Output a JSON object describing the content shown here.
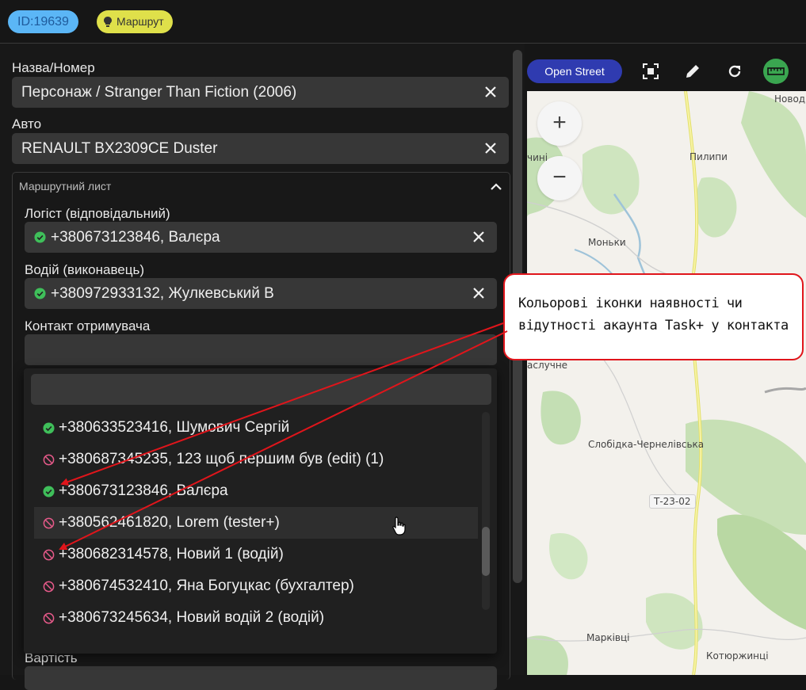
{
  "topbar": {
    "id_badge": "ID:19639",
    "route_badge": "Маршрут"
  },
  "form": {
    "name_label": "Назва/Номер",
    "name_value": "Персонаж / Stranger Than Fiction (2006)",
    "auto_label": "Авто",
    "auto_value": "RENAULT BX2309CE Duster",
    "section_title": "Маршрутний лист",
    "logist_label": "Логіст (відповідальний)",
    "logist_value": "+380673123846, Валєра",
    "driver_label": "Водій (виконавець)",
    "driver_value": "+380972933132, Жулкевський В",
    "contact_label": "Контакт отримувача",
    "contact_value": "",
    "cost_label": "Вартість"
  },
  "dropdown": {
    "search_value": "",
    "items": [
      {
        "text": "+380633523416, Шумович Сергій",
        "status": "check"
      },
      {
        "text": "+380687345235, 123 щоб першим був (edit) (1)",
        "status": "no"
      },
      {
        "text": "+380673123846, Валєра",
        "status": "check"
      },
      {
        "text": "+380562461820, Lorem (tester+)",
        "status": "no"
      },
      {
        "text": "+380682314578, Новий 1 (водій)",
        "status": "no"
      },
      {
        "text": "+380674532410, Яна Богуцкас (бухгалтер)",
        "status": "no"
      },
      {
        "text": "+380673245634, Новий водій 2 (водій)",
        "status": "no"
      }
    ]
  },
  "map": {
    "layer_button": "Open Street",
    "zoom_in": "+",
    "zoom_out": "−",
    "places": {
      "novod": "Новод",
      "chyn": "чині",
      "pylypy": "Пилипи",
      "monky": "Моньки",
      "vaslychne": "аслучне",
      "slobidka": "Слобідка-Чернелівська",
      "road": "Т-23-02",
      "markivtsi": "Марківці",
      "kotiuzhyntsi": "Котюржинці"
    }
  },
  "callout": {
    "line1": "Кольорові іконки наявності чи",
    "line2": "відутності акаунта Task+ у контакта"
  },
  "colors": {
    "accent_blue": "#5bb6f6",
    "route_yellow": "#dfe04a",
    "ok_green": "#3fbf5a",
    "no_red": "#e75a8a",
    "annotation_red": "#e0151b"
  }
}
